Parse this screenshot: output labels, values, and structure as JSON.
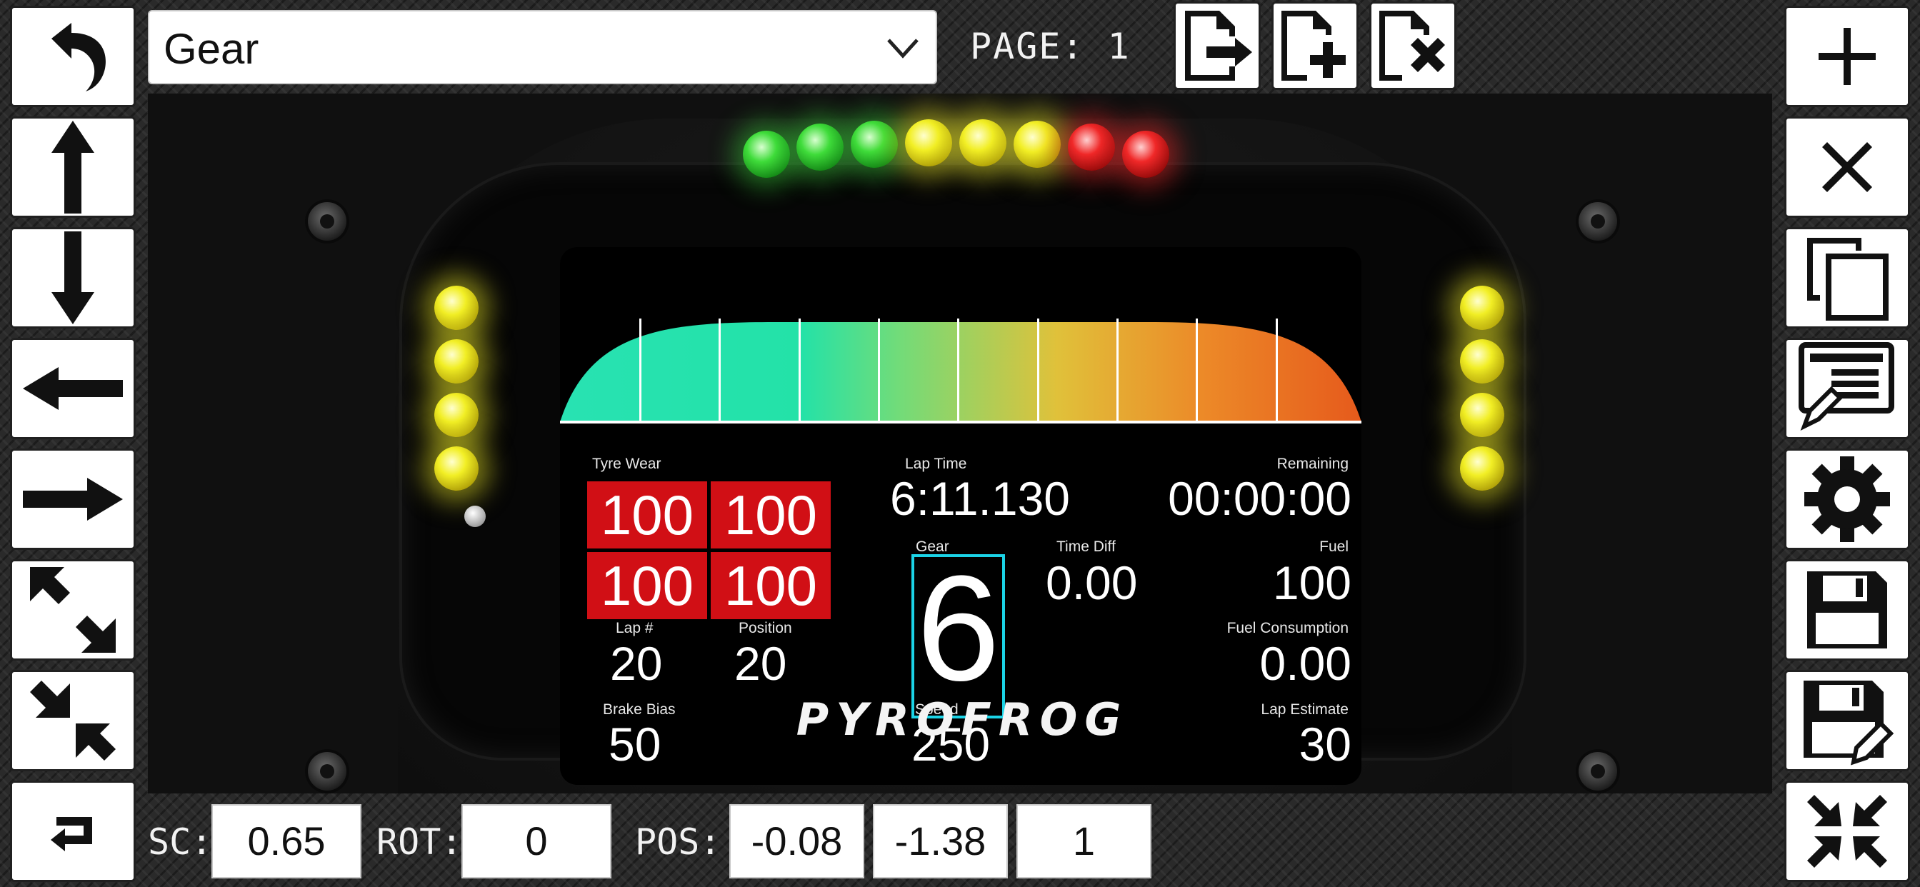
{
  "toolbar": {
    "selected_element": "Gear",
    "page_label": "PAGE: 1"
  },
  "bottom_bar": {
    "scale_label": "SC:",
    "scale_value": "0.65",
    "rotation_label": "ROT:",
    "rotation_value": "0",
    "position_label": "POS:",
    "pos_x": "-0.08",
    "pos_y": "-1.38",
    "pos_z": "1"
  },
  "left_tools": [
    "undo-icon",
    "arrow-up-icon",
    "arrow-down-icon",
    "arrow-left-icon",
    "arrow-right-icon",
    "expand-icon",
    "shrink-icon",
    "return-icon"
  ],
  "right_tools": [
    "plus-icon",
    "close-icon",
    "duplicate-icon",
    "edit-list-icon",
    "gear-settings-icon",
    "save-icon",
    "save-as-icon",
    "collapse-icon"
  ],
  "dash": {
    "brand": "PYROFROG",
    "shift_leds": [
      "green",
      "green",
      "green",
      "yellow",
      "yellow",
      "yellow",
      "red",
      "red"
    ],
    "side_leds": [
      "yellow",
      "yellow",
      "yellow",
      "yellow"
    ],
    "tyre_wear_label": "Tyre Wear",
    "tyre_wear": [
      "100",
      "100",
      "100",
      "100"
    ],
    "lap_time_label": "Lap Time",
    "lap_time": "6:11.130",
    "remaining_label": "Remaining",
    "remaining": "00:00:00",
    "gear_label": "Gear",
    "gear": "6",
    "time_diff_label": "Time Diff",
    "time_diff": "0.00",
    "fuel_label": "Fuel",
    "fuel": "100",
    "lap_num_label": "Lap #",
    "lap_num": "20",
    "position_label": "Position",
    "position": "20",
    "fuel_consumption_label": "Fuel Consumption",
    "fuel_consumption": "0.00",
    "brake_bias_label": "Brake Bias",
    "brake_bias": "50",
    "speed_label": "Speed",
    "speed": "250",
    "lap_estimate_label": "Lap Estimate",
    "lap_estimate": "30"
  },
  "colors": {
    "tyre_red": "#d10f15",
    "selection_cyan": "#1bd3e6"
  }
}
